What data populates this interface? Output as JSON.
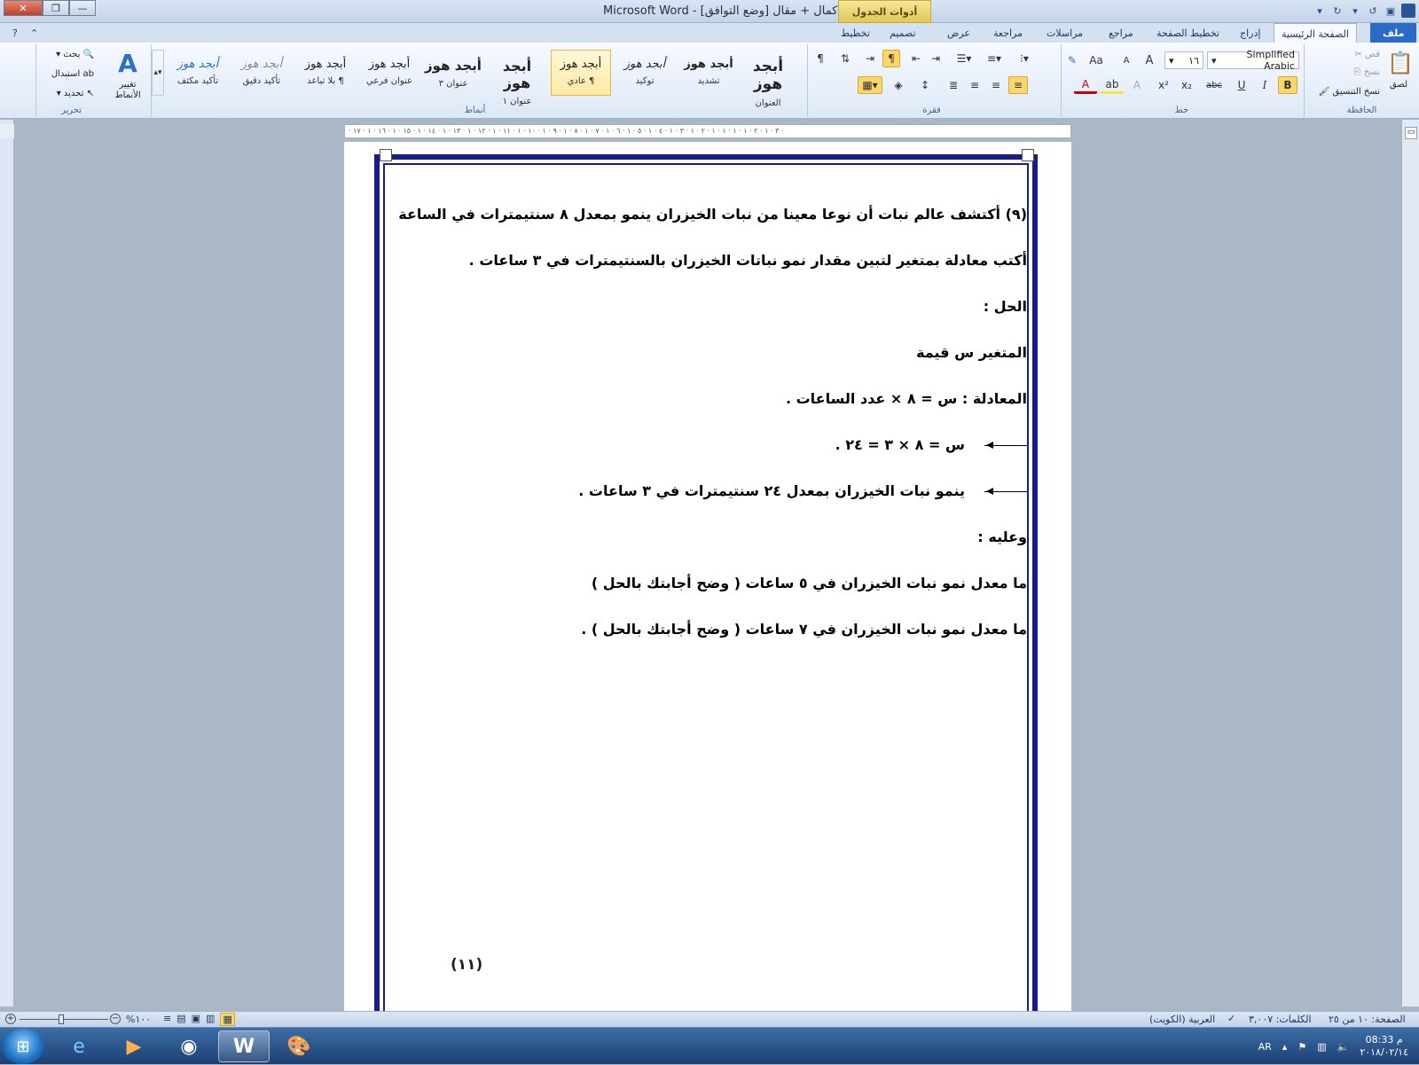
{
  "window": {
    "title": "اكمال + مقال [وضع التوافق] - Microsoft Word",
    "contextual_tab": "أدوات الجدول",
    "close": "✕",
    "maximize": "❐",
    "minimize": "—"
  },
  "qat": {
    "word_icon": "W"
  },
  "tabs": [
    "ملف",
    "الصفحة الرئيسية",
    "إدراج",
    "تخطيط الصفحة",
    "مراجع",
    "مراسلات",
    "مراجعة",
    "عرض",
    "تصميم",
    "تخطيط"
  ],
  "clipboard": {
    "paste": "لصق",
    "cut": "قص",
    "copy": "نسخ",
    "format_painter": "نسخ التنسيق",
    "label": "الحافظة"
  },
  "font": {
    "name": "Simplified Arabic",
    "size": "١٦",
    "label": "خط",
    "bold": "B",
    "italic": "I",
    "underline": "U",
    "strike": "abc",
    "subscript": "x₂",
    "superscript": "x²",
    "grow": "A",
    "shrink": "A",
    "case": "Aa"
  },
  "paragraph": {
    "label": "فقرة",
    "pilcrow": "¶"
  },
  "styles": {
    "label": "أنماط",
    "items": [
      {
        "sample": "أبجد هوز",
        "name": "العنوان"
      },
      {
        "sample": "أبجد هوز",
        "name": "تشديد"
      },
      {
        "sample": "أبجد هوز",
        "name": "توكيد"
      },
      {
        "sample": "أبجد هوز",
        "name": "¶ عادي"
      },
      {
        "sample": "أبجد هوز",
        "name": "عنوان ١"
      },
      {
        "sample": "أبجد هوز",
        "name": "عنوان ٣"
      },
      {
        "sample": "أبجد هوز",
        "name": "عنوان فرعي"
      },
      {
        "sample": "أبجد هوز",
        "name": "¶ بلا تباعد"
      },
      {
        "sample": "أبجد هوز",
        "name": "تأكيد دقيق"
      },
      {
        "sample": "أبجد هوز",
        "name": "تأكيد مكثف"
      }
    ],
    "change_styles": "تغيير الأنماط"
  },
  "editing": {
    "label": "تحرير",
    "find": "بحث",
    "replace": "استبدال",
    "select": "تحديد"
  },
  "ruler": {
    "text": "· ٣ · ١ · ٢ · ١ · ١ · ١ · ١ · ٢ · ١ · ٣ · ١ · ٤ · ١ · ٥ · ١ · ٦ · ١ · ٧ · ١ · ٨ · ١ · ٩ · ١ · ١٠ · ١ · ١١ · ١ · ١٢ · ١ · ١٣ · ١ · ١٤ · ١ · ١٥ · ١ · ١٦ · ١ · ١٧ ·"
  },
  "document": {
    "lines": [
      "(٩) أكتشف عالم نبات أن نوعا معينا من نبات الخيزران ينمو بمعدل ٨ سنتيمترات في الساعة",
      "أكتب معادلة بمتغير لتبين مقدار نمو نباتات الخيزران بالسنتيمترات في ٣ ساعات .",
      "الحل :",
      "المتغير        س   قيمة",
      "المعادلة :     س   =   ٨   ×   عدد الساعات   .",
      "س = ٨ × ٣    =    ٢٤   .",
      "ينمو نبات الخيزران بمعدل          ٢٤   سنتيمترات في ٣ ساعات  .",
      "وعليه :",
      "ما معدل نمو نبات الخيزران في ٥ ساعات  ( وضح أجابتك بالحل )",
      "ما معدل نمو نبات الخيزران في ٧ ساعات ( وضح أجابتك بالحل ) ."
    ],
    "page_number": "(١١)"
  },
  "status": {
    "page": "الصفحة: ١٠ من ٢٥",
    "words": "الكلمات: ٣,٠٠٧",
    "language": "العربية (الكويت)",
    "zoom": "%١٠٠"
  },
  "taskbar": {
    "time": "08:33 م",
    "date": "٢٠١٨/٠٢/١٤",
    "lang": "AR"
  }
}
